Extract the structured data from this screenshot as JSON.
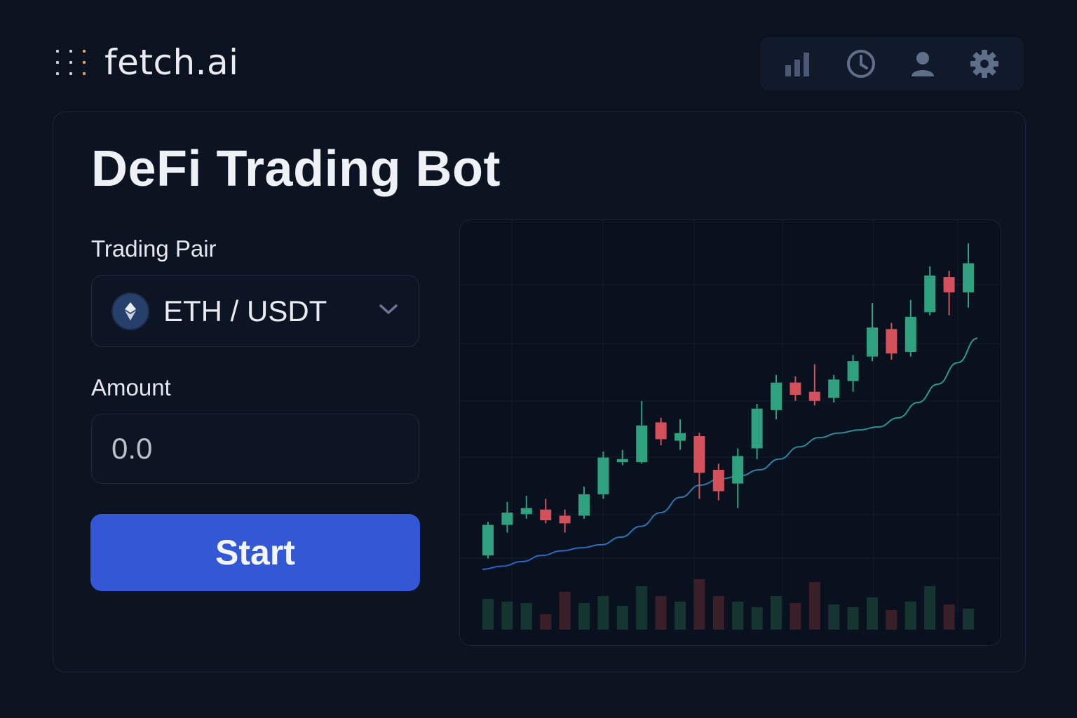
{
  "brand": {
    "name": "fetch.ai"
  },
  "toolbar": {
    "icons": [
      "bar-chart-icon",
      "clock-icon",
      "user-icon",
      "gear-icon"
    ],
    "color": "#5f6f8a"
  },
  "main": {
    "title": "DeFi Trading Bot",
    "pair_label": "Trading Pair",
    "pair_value": "ETH / USDT",
    "amount_label": "Amount",
    "amount_placeholder": "0.0",
    "start_label": "Start"
  },
  "colors": {
    "accent": "#3457d5",
    "up": "#2fa17f",
    "down": "#d4505a",
    "background": "#0b1220"
  },
  "chart_data": {
    "type": "candlestick",
    "candles": [
      {
        "o": 20,
        "c": 60,
        "h": 64,
        "l": 16
      },
      {
        "o": 60,
        "c": 76,
        "h": 90,
        "l": 50
      },
      {
        "o": 74,
        "c": 82,
        "h": 98,
        "l": 68
      },
      {
        "o": 80,
        "c": 66,
        "h": 94,
        "l": 62
      },
      {
        "o": 72,
        "c": 62,
        "h": 80,
        "l": 50
      },
      {
        "o": 72,
        "c": 100,
        "h": 110,
        "l": 68
      },
      {
        "o": 100,
        "c": 148,
        "h": 156,
        "l": 94
      },
      {
        "o": 142,
        "c": 146,
        "h": 158,
        "l": 138
      },
      {
        "o": 142,
        "c": 190,
        "h": 222,
        "l": 140
      },
      {
        "o": 194,
        "c": 172,
        "h": 200,
        "l": 164
      },
      {
        "o": 170,
        "c": 180,
        "h": 198,
        "l": 158
      },
      {
        "o": 176,
        "c": 128,
        "h": 180,
        "l": 94
      },
      {
        "o": 132,
        "c": 104,
        "h": 140,
        "l": 92
      },
      {
        "o": 114,
        "c": 150,
        "h": 160,
        "l": 82
      },
      {
        "o": 160,
        "c": 212,
        "h": 218,
        "l": 146
      },
      {
        "o": 210,
        "c": 246,
        "h": 256,
        "l": 198
      },
      {
        "o": 246,
        "c": 230,
        "h": 254,
        "l": 222
      },
      {
        "o": 234,
        "c": 222,
        "h": 270,
        "l": 216
      },
      {
        "o": 226,
        "c": 250,
        "h": 256,
        "l": 220
      },
      {
        "o": 248,
        "c": 274,
        "h": 282,
        "l": 234
      },
      {
        "o": 280,
        "c": 318,
        "h": 350,
        "l": 274
      },
      {
        "o": 316,
        "c": 284,
        "h": 324,
        "l": 276
      },
      {
        "o": 286,
        "c": 332,
        "h": 354,
        "l": 280
      },
      {
        "o": 338,
        "c": 386,
        "h": 398,
        "l": 334
      },
      {
        "o": 384,
        "c": 364,
        "h": 392,
        "l": 334
      },
      {
        "o": 364,
        "c": 402,
        "h": 428,
        "l": 344
      }
    ],
    "moving_average": [
      2,
      6,
      12,
      20,
      26,
      30,
      34,
      44,
      58,
      76,
      96,
      112,
      120,
      124,
      132,
      146,
      162,
      174,
      180,
      184,
      188,
      200,
      220,
      244,
      272,
      304
    ],
    "volume": [
      44,
      40,
      38,
      22,
      54,
      38,
      48,
      34,
      62,
      48,
      40,
      72,
      48,
      40,
      32,
      48,
      38,
      68,
      36,
      32,
      46,
      28,
      40,
      62,
      36,
      30
    ],
    "y_range": [
      0,
      440
    ],
    "grid": true
  }
}
